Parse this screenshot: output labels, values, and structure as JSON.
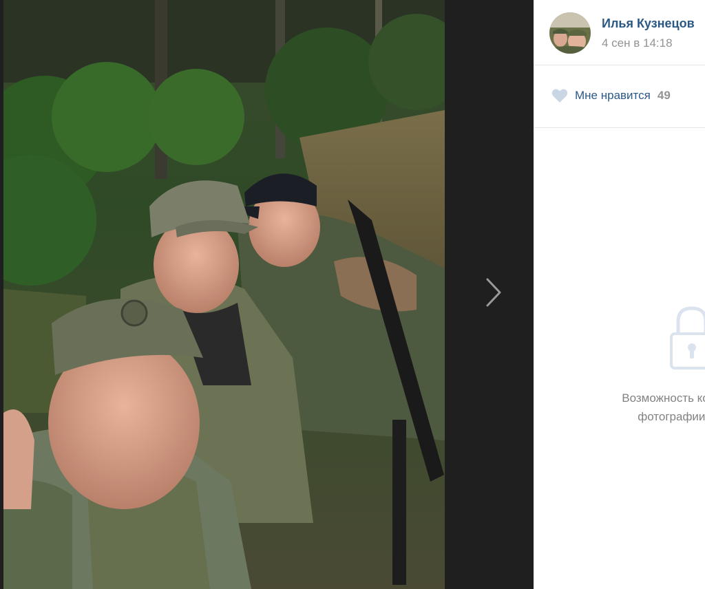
{
  "author": {
    "name": "Илья Кузнецов",
    "date": "4 сен в 14:18",
    "avatar_icon": "avatar-photo"
  },
  "likes": {
    "label": "Мне нравится",
    "count": "49",
    "icon": "heart-icon"
  },
  "comments": {
    "closed_line1": "Возможность комментировать",
    "closed_line2": "фотографии ограничена",
    "icon": "lock-icon"
  },
  "navigation": {
    "next_icon": "chevron-right-icon"
  },
  "colors": {
    "link": "#2a5885",
    "muted": "#939393",
    "viewer_bg": "#1f1f1f",
    "panel_bg": "#ffffff"
  }
}
